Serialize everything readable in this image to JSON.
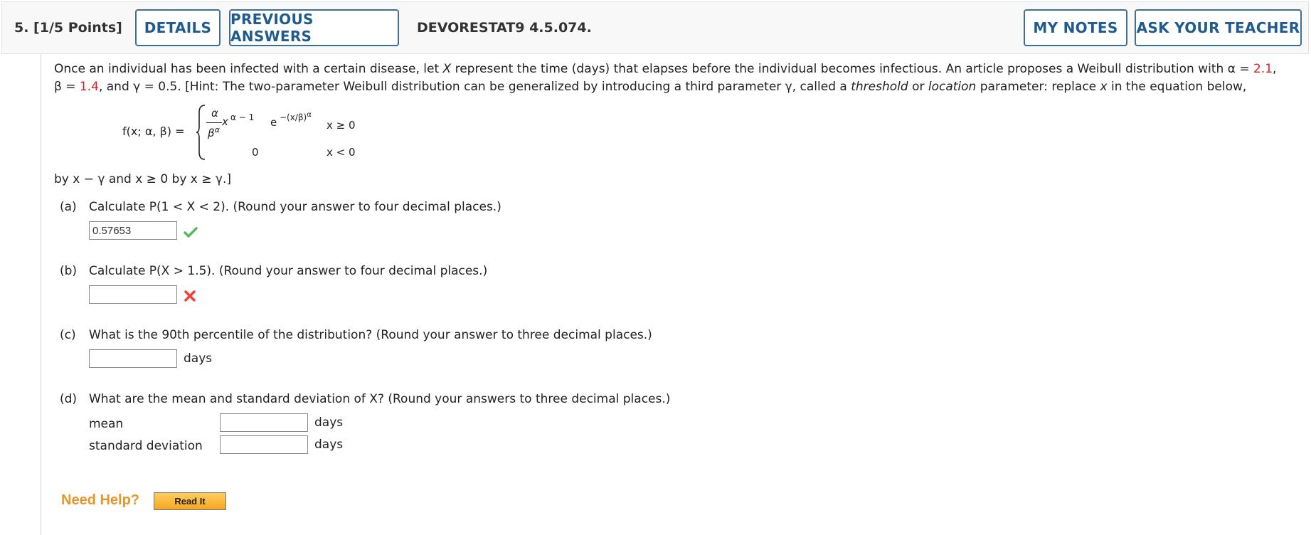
{
  "header": {
    "question_label": "5.  [1/5 Points]",
    "details_button": "DETAILS",
    "previous_answers_button": "PREVIOUS ANSWERS",
    "assignment_code": "DEVORESTAT9 4.5.074.",
    "my_notes_button": "MY NOTES",
    "ask_teacher_button": "ASK YOUR TEACHER"
  },
  "problem": {
    "intro_1": "Once an individual has been infected with a certain disease, let ",
    "var_X": "X",
    "intro_2": " represent the time (days) that elapses before the individual becomes infectious. An article proposes a Weibull distribution with ",
    "alpha_eq": "α = ",
    "alpha_val": "2.1",
    "beta_eq": ", β = ",
    "beta_val": "1.4",
    "intro_3": ", and γ = 0.5. [Hint: The two-parameter Weibull distribution can be generalized by introducing a third parameter γ, called a ",
    "threshold": "threshold",
    "or": " or ",
    "location": "location",
    "intro_4": " parameter: replace ",
    "var_x": "x",
    "intro_5": " in the equation below,",
    "hint_end": "by x − γ and x ≥ 0 by x ≥ γ.]"
  },
  "formula": {
    "lhs": "f(x; α, β) =",
    "numerator": "α",
    "denominator": "β",
    "den_sup": "α",
    "x": "x",
    "sup1": "α − 1",
    "e": "e",
    "sup2": "−(x/β)",
    "sup2_alpha": "α",
    "cond1": "x ≥ 0",
    "zero": "0",
    "cond2": "x < 0"
  },
  "parts": {
    "a": {
      "label": "(a)",
      "text": "Calculate P(1 < X < 2). (Round your answer to four decimal places.)",
      "value": "0.57653",
      "status": "correct"
    },
    "b": {
      "label": "(b)",
      "text": "Calculate P(X > 1.5). (Round your answer to four decimal places.)",
      "value": "",
      "status": "incorrect"
    },
    "c": {
      "label": "(c)",
      "text": "What is the 90th percentile of the distribution? (Round your answer to three decimal places.)",
      "value": "",
      "unit": "days"
    },
    "d": {
      "label": "(d)",
      "text": "What are the mean and standard deviation of X? (Round your answers to three decimal places.)",
      "mean_label": "mean",
      "mean_value": "",
      "mean_unit": "days",
      "sd_label": "standard deviation",
      "sd_value": "",
      "sd_unit": "days"
    }
  },
  "help": {
    "need_help": "Need Help?",
    "read_it_button": "Read It"
  },
  "colors": {
    "accent": "#1f5b8e",
    "red": "#e02020",
    "correct": "#5cb85c",
    "incorrect": "#e8413a",
    "help": "#e8952a"
  },
  "icons": {
    "correct": "check-icon",
    "incorrect": "x-icon"
  }
}
